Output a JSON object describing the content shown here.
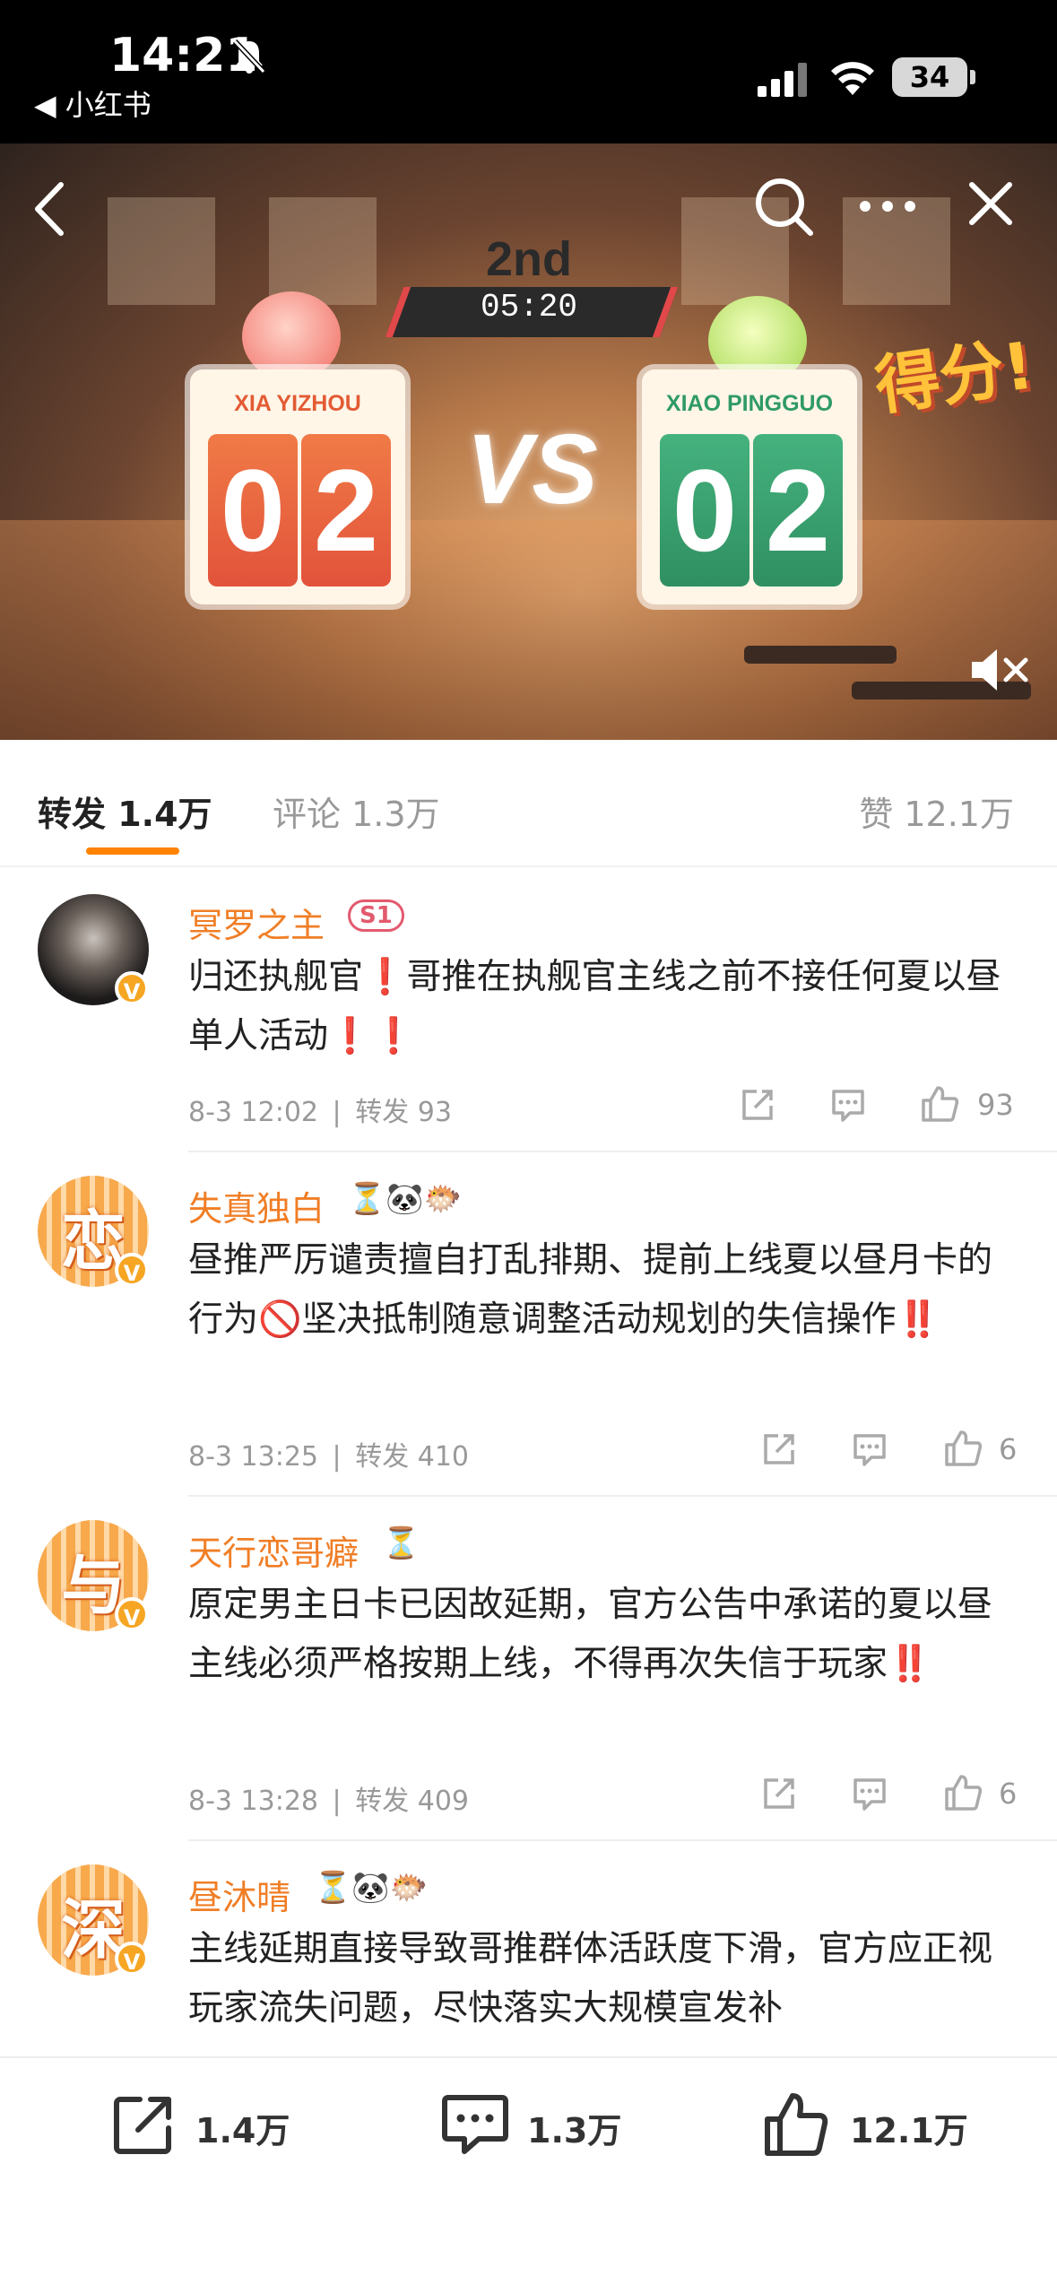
{
  "status_bar": {
    "time": "14:21",
    "back_app": "◀ 小红书",
    "battery": "34",
    "icons": [
      "bell-muted-icon",
      "signal-icon",
      "wifi-icon",
      "battery-icon"
    ]
  },
  "video": {
    "round": "2nd",
    "timer": "05:20",
    "left_name": "XIA YIZHOU",
    "left_score_1": "0",
    "left_score_2": "2",
    "right_name": "XIAO PINGGUO",
    "right_score_1": "0",
    "right_score_2": "2",
    "vs": "VS",
    "banner": "得分!",
    "icons": [
      "back-icon",
      "search-icon",
      "more-icon",
      "close-icon",
      "mute-icon"
    ]
  },
  "tabs": {
    "reposts": "转发 1.4万",
    "comments": "评论 1.3万",
    "likes": "赞 12.1万"
  },
  "posts": [
    {
      "username": "冥罗之主",
      "badge": "S1",
      "verified": "V",
      "content": "归还执舰官❗哥推在执舰官主线之前不接任何夏以昼单人活动❗❗",
      "time": "8-3 12:02",
      "sep": "|",
      "reposts": "转发 93",
      "likes": "93"
    },
    {
      "username": "失真独白",
      "emoji": "⏳🐼🐡",
      "avatar_char": "恋",
      "verified": "V",
      "content": "昼推严厉谴责擅自打乱排期、提前上线夏以昼月卡的行为🚫坚决抵制随意调整活动规划的失信操作‼️",
      "time": "8-3 13:25",
      "sep": "|",
      "reposts": "转发 410",
      "likes": "6"
    },
    {
      "username": "天行恋哥癖",
      "emoji": "⏳",
      "avatar_char": "与",
      "verified": "V",
      "content": "原定男主日卡已因故延期，官方公告中承诺的夏以昼主线必须严格按期上线，不得再次失信于玩家‼️",
      "time": "8-3 13:28",
      "sep": "|",
      "reposts": "转发 409",
      "likes": "6"
    },
    {
      "username": "昼沐晴",
      "emoji": "⏳🐼🐡",
      "avatar_char": "深",
      "verified": "V",
      "content": "主线延期直接导致哥推群体活跃度下滑，官方应正视玩家流失问题，尽快落实大规模宣发补"
    }
  ],
  "bottom_bar": {
    "reposts": "1.4万",
    "comments": "1.3万",
    "likes": "12.1万"
  },
  "colors": {
    "accent": "#ff8200",
    "username": "#f07e26",
    "muted": "#999999"
  }
}
